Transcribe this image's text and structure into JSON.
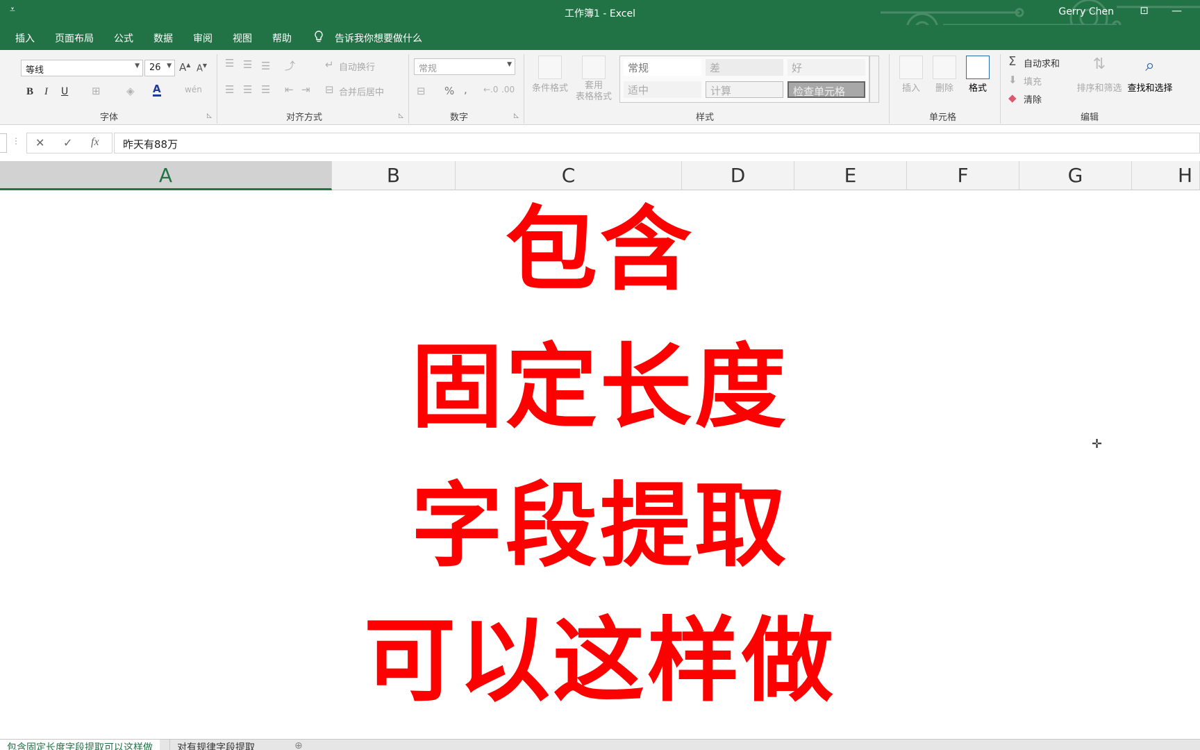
{
  "window": {
    "title": "工作簿1  -  Excel",
    "user": "Gerry Chen",
    "qat_icon": "customize-qat-icon",
    "ribbon_display_icon": "ribbon-display-options-icon",
    "minimize_icon": "minimize-icon"
  },
  "menu": {
    "tabs": [
      "插入",
      "页面布局",
      "公式",
      "数据",
      "审阅",
      "视图",
      "帮助"
    ],
    "tell_me": "告诉我你想要做什么"
  },
  "ribbon": {
    "font": {
      "name": "等线",
      "size": "26",
      "bold": "B",
      "italic": "I",
      "underline": "U",
      "group_label": "字体"
    },
    "alignment": {
      "wrap_text": "自动换行",
      "merge_center": "合并后居中",
      "group_label": "对齐方式"
    },
    "number": {
      "format": "常规",
      "percent": "%",
      "comma": ",",
      "group_label": "数字"
    },
    "styles": {
      "conditional_format": "条件格式",
      "table_format_line1": "套用",
      "table_format_line2": "表格格式",
      "gallery": {
        "normal": "常规",
        "bad": "差",
        "good": "好",
        "neutral": "适中",
        "calculation": "计算",
        "check_cell": "检查单元格"
      },
      "group_label": "样式"
    },
    "cells": {
      "insert": "插入",
      "delete": "删除",
      "format": "格式",
      "group_label": "单元格"
    },
    "editing": {
      "autosum": "自动求和",
      "fill": "填充",
      "clear": "清除",
      "sort_filter": "排序和筛选",
      "find_select": "查找和选择",
      "group_label": "编辑"
    },
    "colors": {
      "excel_green": "#217346",
      "bad_fill": "#ffc7ce",
      "good_fill": "#c6efce",
      "neutral_fill": "#ffeb9c",
      "check_fill": "#a5a5a5"
    }
  },
  "formula_bar": {
    "cancel": "✕",
    "enter": "✓",
    "fx": "fx",
    "value": "昨天有88万"
  },
  "columns": [
    "A",
    "B",
    "C",
    "D",
    "E",
    "F",
    "G",
    "H"
  ],
  "selected_column": "A",
  "overlay": {
    "line1": "包含",
    "line2": "固定长度",
    "line3": "字段提取",
    "line4": "可以这样做",
    "color": "#ff0000"
  },
  "sheets": {
    "tabs": [
      "包含固定长度字段提取可以这样做",
      "对有规律字段提取"
    ],
    "active_index": 0,
    "add_icon": "new-sheet-icon"
  }
}
